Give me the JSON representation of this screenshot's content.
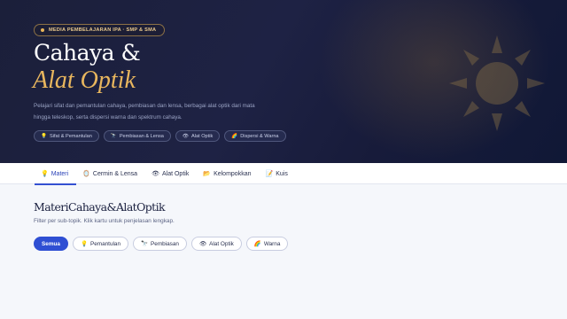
{
  "hero": {
    "badge": "MEDIA PEMBELAJARAN IPA · SMP & SMA",
    "title_line1": "Cahaya &",
    "title_line2": "Alat Optik",
    "description": "Pelajari sifat dan pemantulan cahaya, pembiasan dan lensa, berbagai alat optik dari mata hingga teleskop, serta dispersi warna dan spektrum cahaya.",
    "chips": [
      {
        "icon": "💡",
        "label": "Sifat & Pemantulan"
      },
      {
        "icon": "🔭",
        "label": "Pembiasan & Lensa"
      },
      {
        "icon": "👁",
        "label": "Alat Optik"
      },
      {
        "icon": "🌈",
        "label": "Dispersi & Warna"
      }
    ]
  },
  "nav": {
    "tabs": [
      {
        "icon": "💡",
        "label": "Materi",
        "active": true
      },
      {
        "icon": "🪞",
        "label": "Cermin & Lensa",
        "active": false
      },
      {
        "icon": "👁",
        "label": "Alat Optik",
        "active": false
      },
      {
        "icon": "📂",
        "label": "Kelompokkan",
        "active": false
      },
      {
        "icon": "📝",
        "label": "Kuis",
        "active": false
      }
    ]
  },
  "main": {
    "title": "MateriCahaya&AlatOptik",
    "subtitle": "Filter per sub-topik. Klik kartu untuk penjelasan lengkap.",
    "filters": [
      {
        "icon": "",
        "label": "Semua",
        "active": true
      },
      {
        "icon": "💡",
        "label": "Pemantulan",
        "active": false
      },
      {
        "icon": "🔭",
        "label": "Pembiasan",
        "active": false
      },
      {
        "icon": "👁",
        "label": "Alat Optik",
        "active": false
      },
      {
        "icon": "🌈",
        "label": "Warna",
        "active": false
      }
    ]
  },
  "colors": {
    "hero_bg": "#1b1f3a",
    "accent_gold": "#e8b65e",
    "accent_blue": "#2f4fd3"
  }
}
